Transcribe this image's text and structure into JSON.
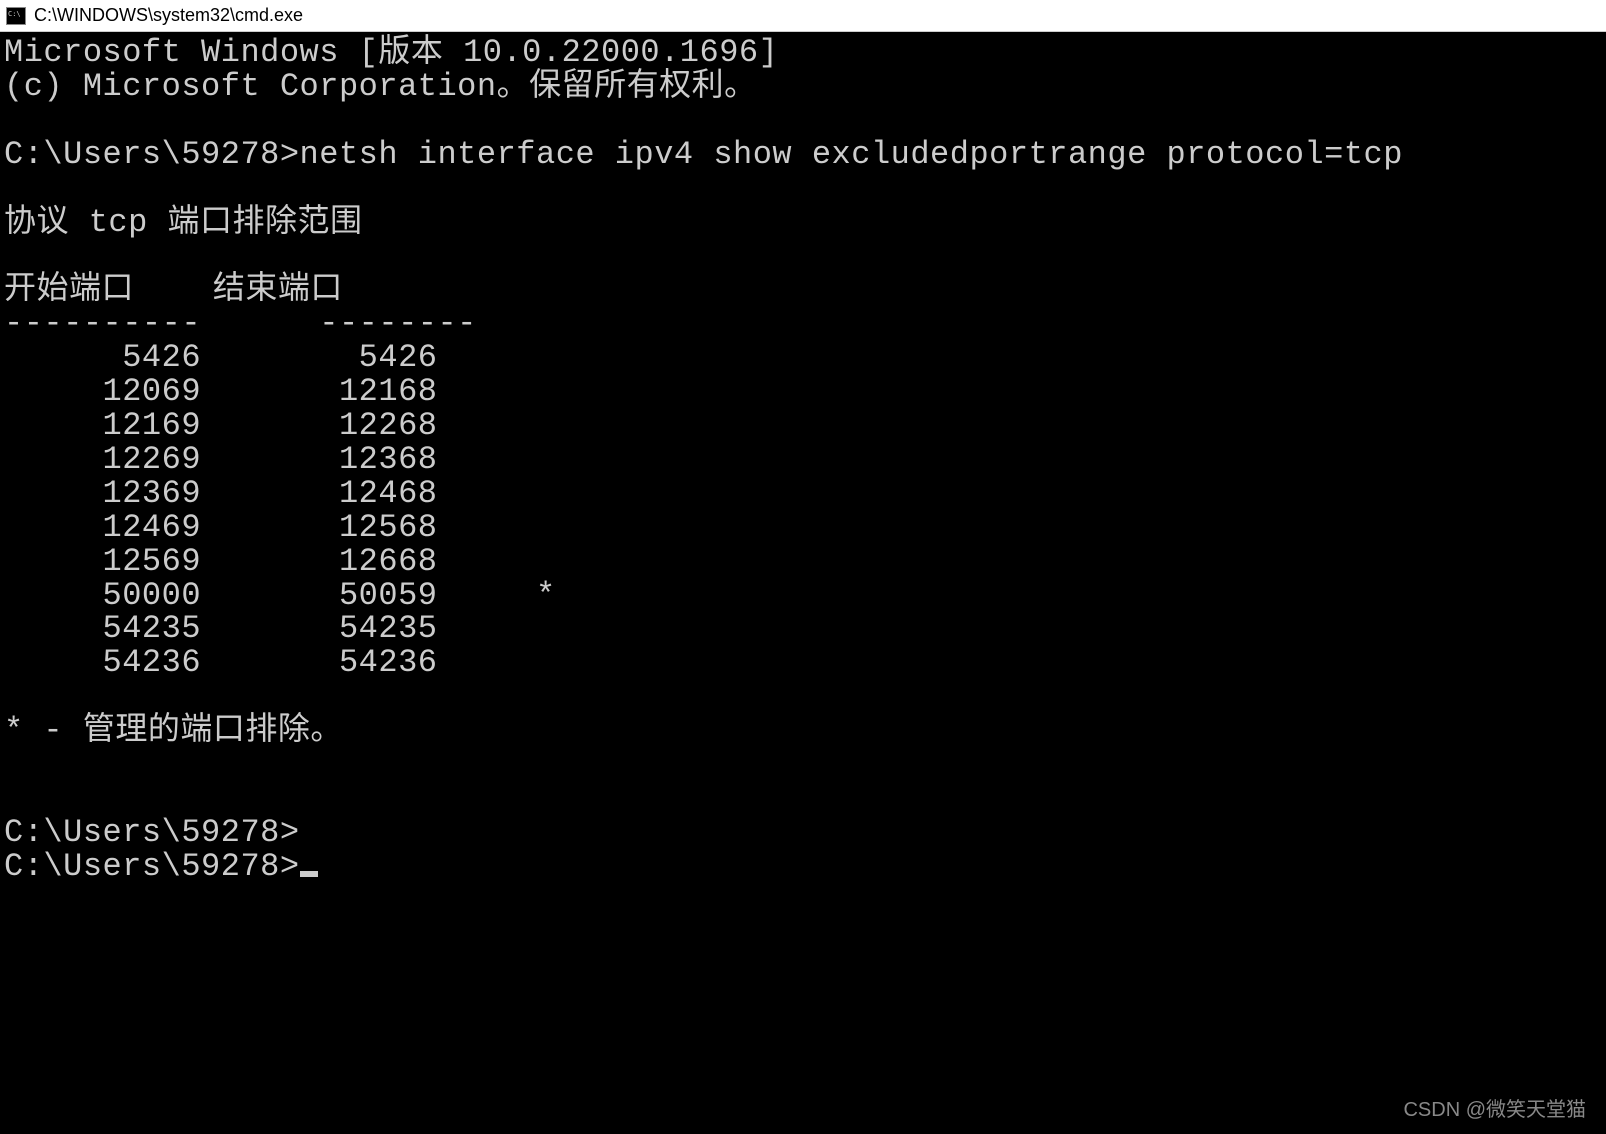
{
  "window": {
    "title": "C:\\WINDOWS\\system32\\cmd.exe"
  },
  "terminal": {
    "line1": "Microsoft Windows [版本 10.0.22000.1696]",
    "line2": "(c) Microsoft Corporation。保留所有权利。",
    "blank1": "",
    "prompt1": "C:\\Users\\59278>netsh interface ipv4 show excludedportrange protocol=tcp",
    "blank2": "",
    "header": "协议 tcp 端口排除范围",
    "blank3": "",
    "col_header": "开始端口    结束端口",
    "divider": "----------      --------",
    "row1": "      5426        5426",
    "row2": "     12069       12168",
    "row3": "     12169       12268",
    "row4": "     12269       12368",
    "row5": "     12369       12468",
    "row6": "     12469       12568",
    "row7": "     12569       12668",
    "row8": "     50000       50059     *",
    "row9": "     54235       54235",
    "row10": "     54236       54236",
    "blank4": "",
    "note": "* - 管理的端口排除。",
    "blank5": "",
    "blank6": "",
    "prompt2": "C:\\Users\\59278>",
    "prompt3": "C:\\Users\\59278>"
  },
  "watermark": "CSDN @微笑天堂猫"
}
